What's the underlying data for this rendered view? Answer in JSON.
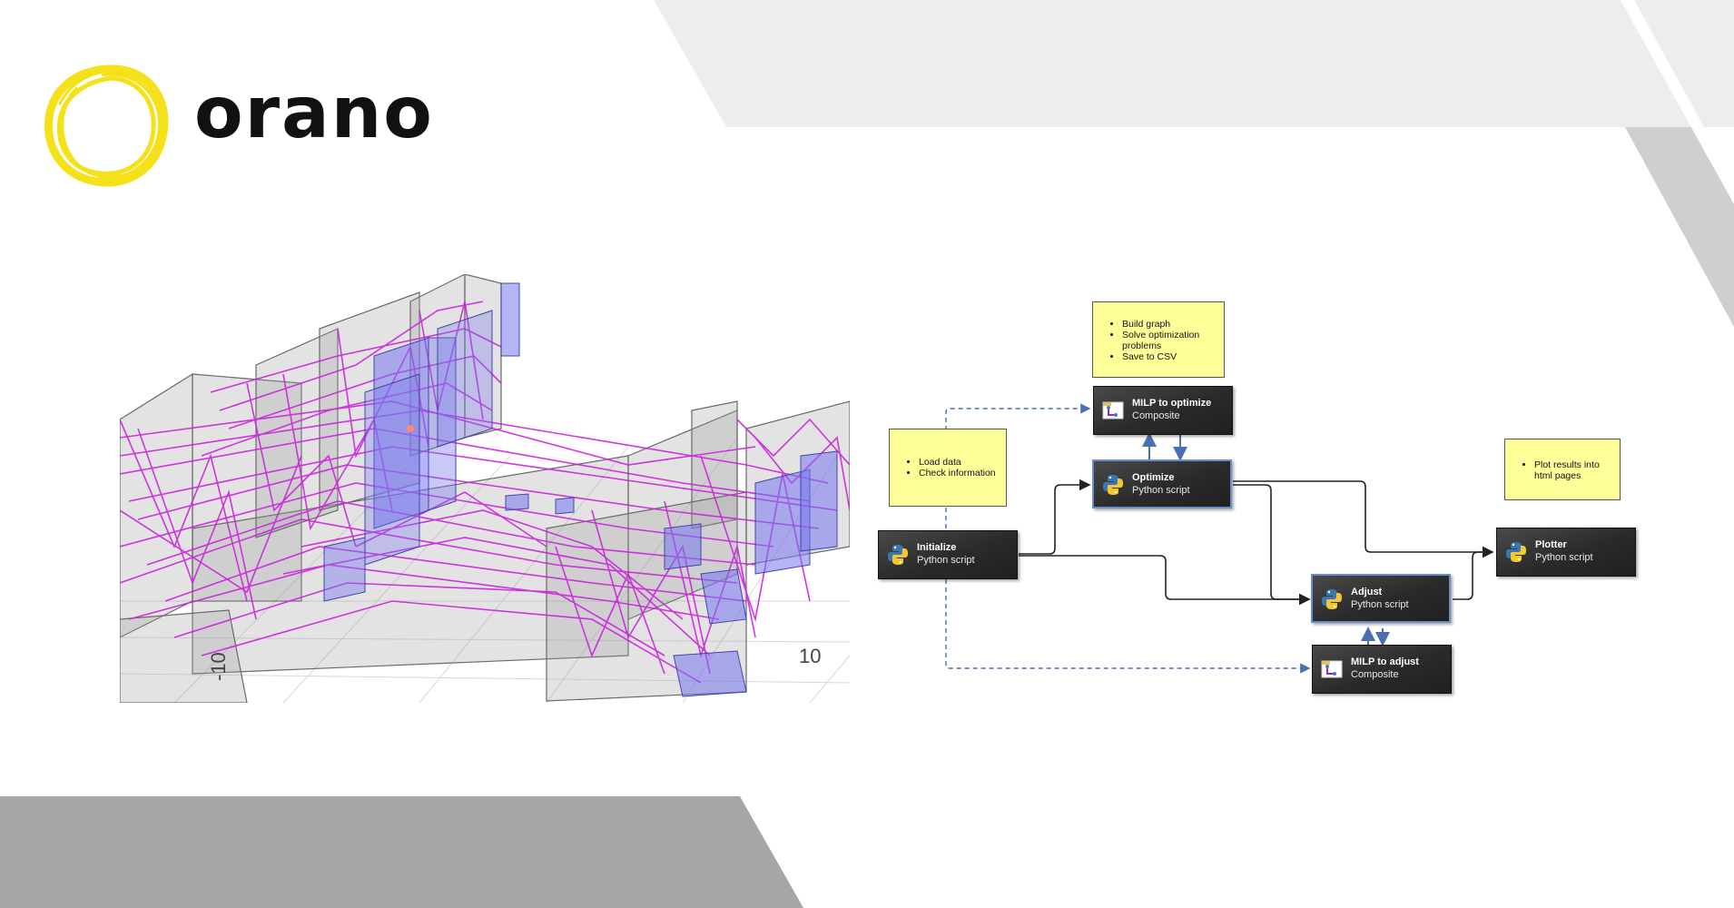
{
  "brand": {
    "name": "orano",
    "logo_color": "#f5e11a"
  },
  "render": {
    "axis_labels": [
      "-10",
      "10"
    ]
  },
  "notes": {
    "optimize": [
      "Build graph",
      "Solve optimization problems",
      "Save to CSV"
    ],
    "initialize": [
      "Load data",
      "Check information"
    ],
    "plotter": [
      "Plot results into html pages"
    ]
  },
  "nodes": {
    "milp_optimize": {
      "title": "MILP to optimize",
      "subtitle": "Composite",
      "icon": "composite-icon"
    },
    "optimize": {
      "title": "Optimize",
      "subtitle": "Python script",
      "icon": "python-icon"
    },
    "initialize": {
      "title": "Initialize",
      "subtitle": "Python script",
      "icon": "python-icon"
    },
    "plotter": {
      "title": "Plotter",
      "subtitle": "Python script",
      "icon": "python-icon"
    },
    "adjust": {
      "title": "Adjust",
      "subtitle": "Python script",
      "icon": "python-icon"
    },
    "milp_adjust": {
      "title": "MILP to adjust",
      "subtitle": "Composite",
      "icon": "composite-icon"
    }
  },
  "colors": {
    "accent_gray_light": "#ededeb",
    "accent_gray_mid": "#cfcfcf",
    "footer_gray": "#a6a6a6",
    "edge_dark": "#222222",
    "edge_dashed": "#4a6fb5",
    "wire_magenta": "#cc22dd",
    "box_blue": "#7777ee"
  }
}
